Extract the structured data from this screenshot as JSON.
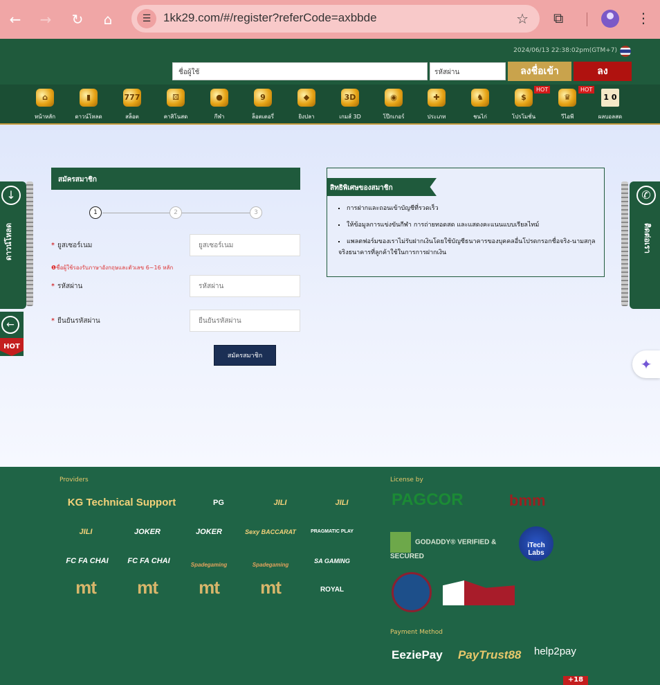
{
  "browser": {
    "url": "1kk29.com/#/register?referCode=axbbde"
  },
  "header": {
    "datetime": "2024/06/13 22:38:02pm(GTM+7)",
    "username_placeholder": "ชื่อผู้ใช้",
    "password_placeholder": "รหัสผ่าน",
    "login_label": "ลงชื่อเข้า",
    "register_label": "ลง"
  },
  "menu": {
    "items": [
      {
        "label": "หน้าหลัก",
        "icon": "home-icon"
      },
      {
        "label": "ดาวน์โหลด",
        "icon": "phone-icon"
      },
      {
        "label": "สล็อต",
        "icon": "slot-777-icon"
      },
      {
        "label": "คาสิโนสด",
        "icon": "dice-icon"
      },
      {
        "label": "กีฬา",
        "icon": "ball-icon"
      },
      {
        "label": "ล็อตเตอรี่",
        "icon": "lottery-ball-icon"
      },
      {
        "label": "ยิงปลา",
        "icon": "fish-icon"
      },
      {
        "label": "เกมส์ 3D",
        "icon": "3d-icon"
      },
      {
        "label": "โป๊กเกอร์",
        "icon": "chip-icon"
      },
      {
        "label": "ประเภท",
        "icon": "gamepad-icon"
      },
      {
        "label": "ชนไก่",
        "icon": "rooster-icon"
      },
      {
        "label": "โปรโมชั่น",
        "icon": "dollar-icon"
      },
      {
        "label": "วีไอพี",
        "icon": "crown-icon"
      },
      {
        "label": "ผลบอลสด",
        "icon": "scoreboard-icon"
      }
    ],
    "hot_label": "HOT",
    "score_text": "1 0"
  },
  "register": {
    "title": "สมัครสมาชิก",
    "steps": [
      "1",
      "2",
      "3"
    ],
    "username_label": "ยูสเซอร์เนม",
    "username_placeholder": "ยูสเซอร์เนม",
    "hint": "ชื่อผู้ใช้รองรับภาษาอังกฤษและตัวเลข 6~16 หลัก",
    "password_label": "รหัสผ่าน",
    "password_placeholder": "รหัสผ่าน",
    "confirm_label": "ยืนยันรหัสผ่าน",
    "confirm_placeholder": "ยืนยันรหัสผ่าน",
    "submit_label": "สมัครสมาชิก"
  },
  "benefits": {
    "title": "สิทธิพิเศษของสมาชิก",
    "items": [
      "การฝากและถอนเข้าบัญชีที่รวดเร็ว",
      "ให้ข้อมูลการแข่งขันกีฬา การถ่ายทอดสด และแสดงคะแนนแบบเรียลไทม์",
      "แพลตฟอร์มของเราไม่รับฝากเงินโดยใช้บัญชีธนาคารของบุคคลอื่นโปรดกรอกชื่อจริง-นามสกุลจริงธนาคารที่ลูกค้าใช้ในการการฝากเงิน"
    ]
  },
  "side": {
    "left_label": "ดาวน์โหลด",
    "right_label": "ติดต่อเรา",
    "hot_label": "HOT"
  },
  "footer": {
    "providers_title": "Providers",
    "providers": [
      "KG Technical Support",
      "PG",
      "JILI",
      "JILI",
      "JILI",
      "JOKER",
      "JOKER",
      "Sexy BACCARAT",
      "PRAGMATIC PLAY",
      "FC FA CHAI",
      "FC FA CHAI",
      "Spadegaming",
      "Spadegaming",
      "SA GAMING",
      "mt",
      "mt",
      "mt",
      "mt",
      "ROYAL"
    ],
    "license_title": "License by",
    "licenses": [
      "PAGCOR",
      "bmm",
      "GODADDY® VERIFIED & SECURED",
      "iTech Labs"
    ],
    "payment_title": "Payment Method",
    "payments": [
      "EeziePay",
      "PayTrust88",
      "help2pay"
    ],
    "age": "+18"
  }
}
